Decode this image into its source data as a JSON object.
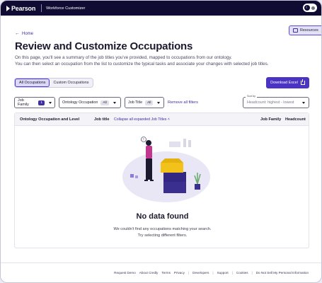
{
  "header": {
    "logo": "Pearson",
    "app_title": "Workforce Customizer"
  },
  "resources_label": "Resources",
  "breadcrumb": {
    "home": "Home"
  },
  "page": {
    "title": "Review and Customize Occupations",
    "desc_line1": "On this page, you'll see a summary of the job titles you've provided, mapped to occupations from our ontology.",
    "desc_line2": "You can then select an occupation from the list to customize the typical tasks and associate your changes with selected job titles."
  },
  "tabs": [
    {
      "label": "All Occupations",
      "active": true
    },
    {
      "label": "Custom Occupations",
      "active": false
    }
  ],
  "download_label": "Download Excel",
  "filters": {
    "job_family": {
      "label": "Job Family",
      "badge": "1"
    },
    "ontology": {
      "label": "Ontology Occupation",
      "badge": "All"
    },
    "job_title": {
      "label": "Job Title",
      "badge": "All"
    },
    "remove_all": "Remove all filters"
  },
  "sort": {
    "label": "Sort by",
    "value": "Headcount: highest - lowest"
  },
  "table": {
    "col_occupation": "Ontology Occupation and Level",
    "col_job_title": "Job title",
    "collapse_label": "Collapse all expanded Job Titles",
    "col_job_family": "Job Family",
    "col_headcount": "Headcount"
  },
  "empty": {
    "title": "No data found",
    "line1": "We couldn't find any occupations matching your search.",
    "line2": "Try selecting different filters."
  },
  "footer": {
    "links": [
      "Request Demo",
      "About Credly",
      "Terms",
      "Privacy",
      "Developers",
      "Support",
      "Cookies",
      "Do Not Sell My Personal Information"
    ]
  },
  "colors": {
    "topbar": "#0f0b33",
    "accent": "#4b33c4",
    "link": "#3b2fa3"
  }
}
